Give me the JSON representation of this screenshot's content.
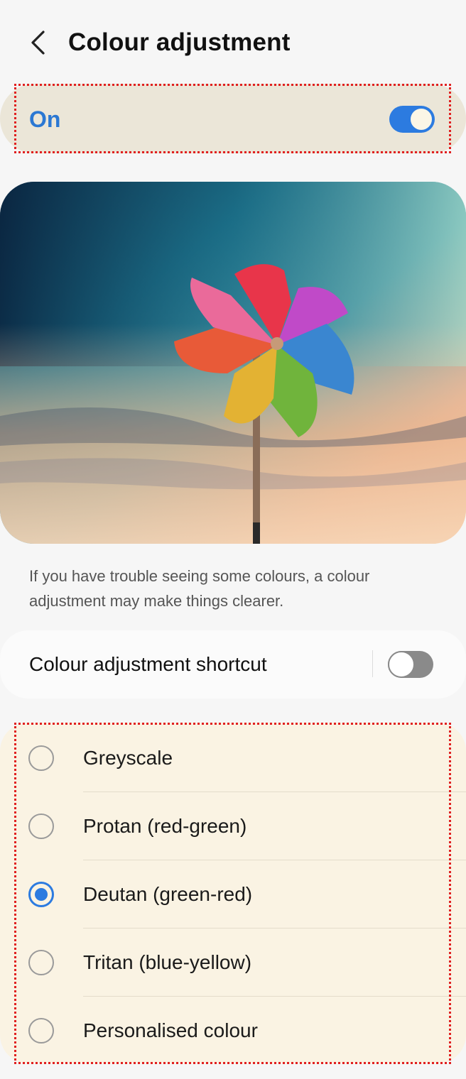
{
  "header": {
    "title": "Colour adjustment",
    "back_icon": "chevron-left-icon"
  },
  "master_switch": {
    "label": "On",
    "state": true,
    "accent_color": "#2c7be0"
  },
  "hero_image": {
    "description_icon": "pinwheel-illustration"
  },
  "description": "If you have trouble seeing some colours, a colour adjustment may make things clearer.",
  "shortcut": {
    "label": "Colour adjustment shortcut",
    "state": false
  },
  "options": [
    {
      "label": "Greyscale",
      "selected": false
    },
    {
      "label": "Protan (red-green)",
      "selected": false
    },
    {
      "label": "Deutan (green-red)",
      "selected": true
    },
    {
      "label": "Tritan (blue-yellow)",
      "selected": false
    },
    {
      "label": "Personalised colour",
      "selected": false
    }
  ],
  "colors": {
    "background": "#f6f6f6",
    "highlight_row": "#ebe6d8",
    "options_card": "#faf3e3",
    "annotation_outline": "#e02020"
  }
}
